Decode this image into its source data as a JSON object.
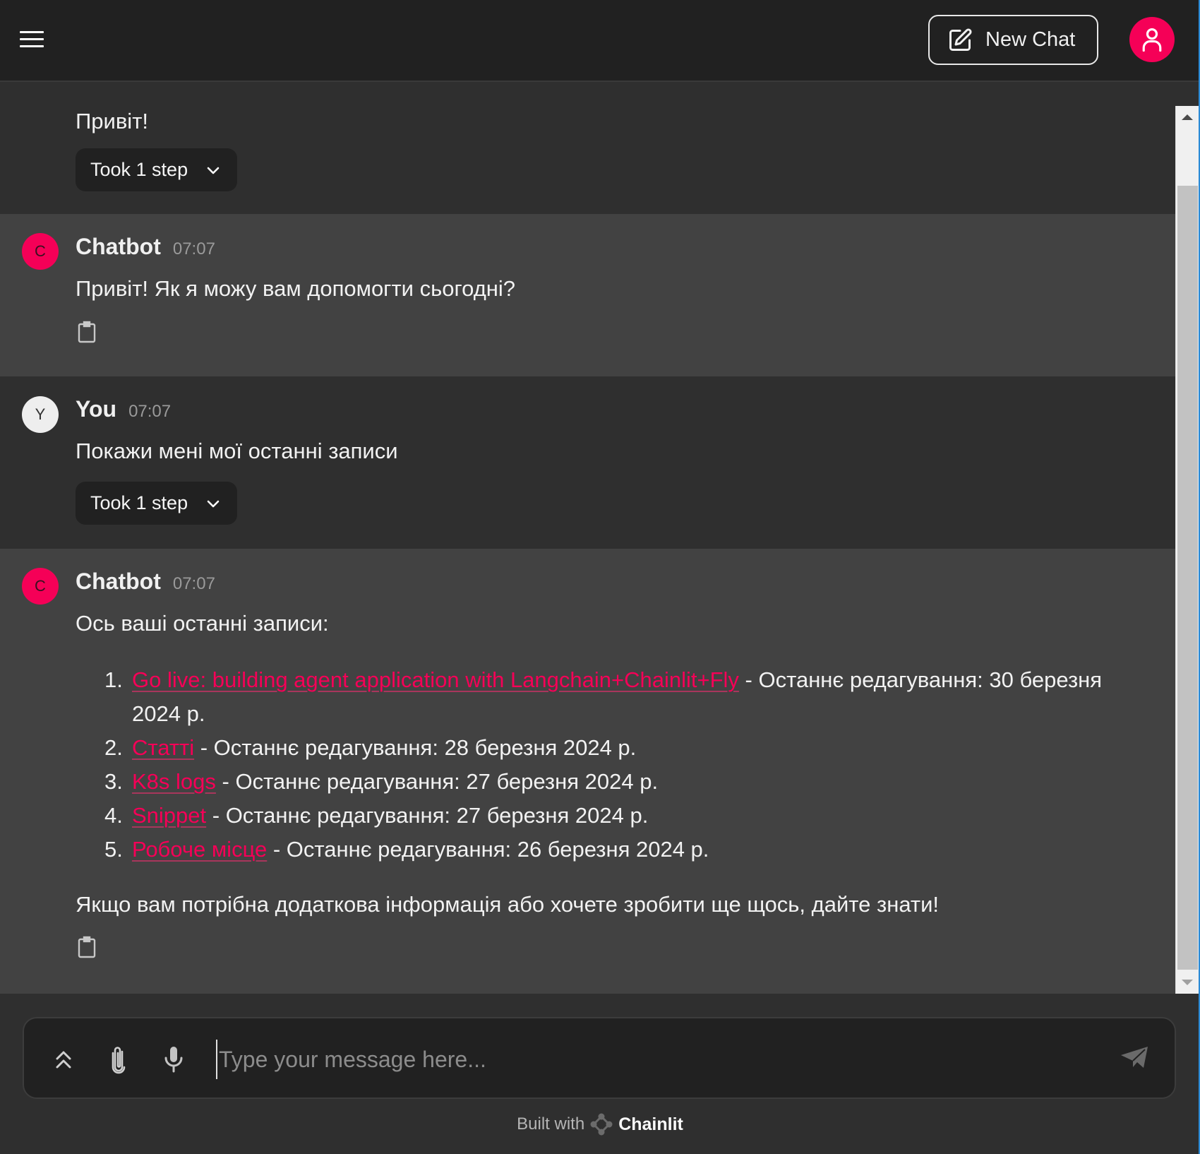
{
  "header": {
    "menu_icon": "hamburger-menu-icon",
    "new_chat_label": "New Chat",
    "new_chat_icon": "edit-square-icon",
    "user_icon": "user-icon",
    "accent_color": "#f50057"
  },
  "messages": [
    {
      "type": "continuation",
      "content": "Привіт!",
      "step_label": "Took 1 step"
    },
    {
      "type": "bot",
      "avatar_letter": "C",
      "author": "Chatbot",
      "time": "07:07",
      "content": "Привіт! Як я можу вам допомогти сьогодні?"
    },
    {
      "type": "user",
      "avatar_letter": "Y",
      "author": "You",
      "time": "07:07",
      "content": "Покажи мені мої останні записи",
      "step_label": "Took 1 step"
    },
    {
      "type": "bot",
      "avatar_letter": "C",
      "author": "Chatbot",
      "time": "07:07",
      "intro": "Ось ваші останні записи:",
      "records": [
        {
          "num": "1.",
          "title": "Go live: building agent application with Langchain+Chainlit+Fly",
          "suffix": " - Останнє редагування: 30 березня 2024 р."
        },
        {
          "num": "2.",
          "title": "Статті",
          "suffix": " - Останнє редагування: 28 березня 2024 р."
        },
        {
          "num": "3.",
          "title": "K8s logs",
          "suffix": " - Останнє редагування: 27 березня 2024 р."
        },
        {
          "num": "4.",
          "title": "Snippet",
          "suffix": " - Останнє редагування: 27 березня 2024 р."
        },
        {
          "num": "5.",
          "title": "Робоче місце",
          "suffix": " - Останнє редагування: 26 березня 2024 р."
        }
      ],
      "outro": "Якщо вам потрібна додаткова інформація або хочете зробити ще щось, дайте знати!"
    }
  ],
  "composer": {
    "placeholder": "Type your message here...",
    "value": "",
    "icons": [
      "chevrons-up-icon",
      "paperclip-icon",
      "microphone-icon",
      "send-icon"
    ]
  },
  "footer": {
    "built_with": "Built with",
    "brand": "Chainlit"
  }
}
